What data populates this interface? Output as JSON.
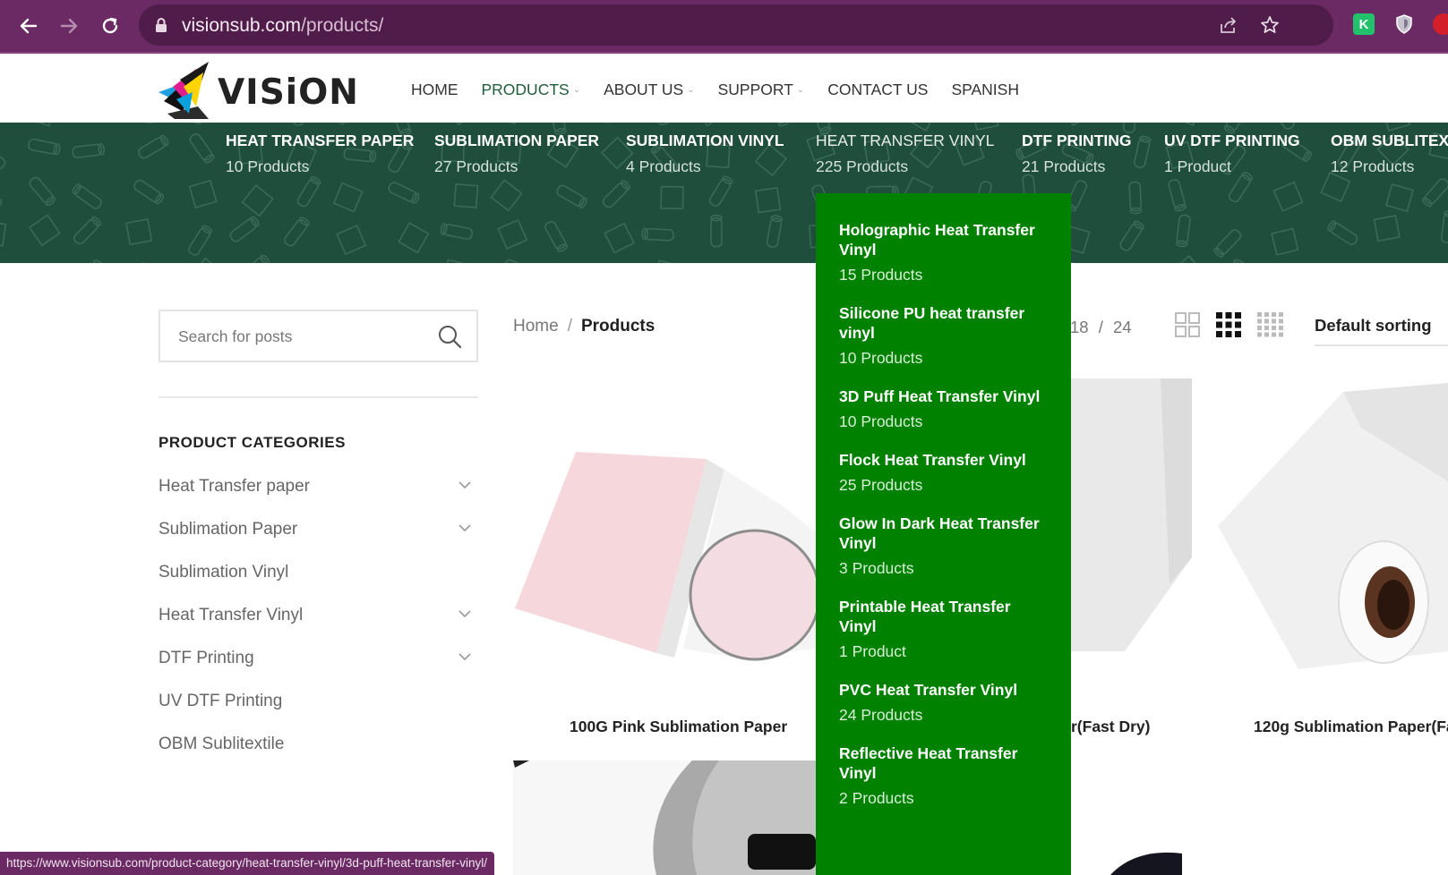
{
  "browser": {
    "url_host": "visionsub.com",
    "url_path": "/products/"
  },
  "site": {
    "logo_text": "VISiON",
    "nav": [
      {
        "label": "HOME",
        "has_dropdown": false,
        "active": false
      },
      {
        "label": "PRODUCTS",
        "has_dropdown": true,
        "active": true
      },
      {
        "label": "ABOUT US",
        "has_dropdown": true,
        "active": false
      },
      {
        "label": "SUPPORT",
        "has_dropdown": true,
        "active": false
      },
      {
        "label": "CONTACT US",
        "has_dropdown": false,
        "active": false
      },
      {
        "label": "SPANISH",
        "has_dropdown": false,
        "active": false
      }
    ]
  },
  "categories_bar": [
    {
      "name": "HEAT TRANSFER PAPER",
      "count": "10 Products"
    },
    {
      "name": "SUBLIMATION PAPER",
      "count": "27 Products"
    },
    {
      "name": "SUBLIMATION VINYL",
      "count": "4 Products"
    },
    {
      "name": "HEAT TRANSFER VINYL",
      "count": "225 Products"
    },
    {
      "name": "DTF PRINTING",
      "count": "21 Products"
    },
    {
      "name": "UV DTF PRINTING",
      "count": "1 Product"
    },
    {
      "name": "OBM SUBLITEXTI",
      "count": "12 Products"
    }
  ],
  "dropdown": [
    {
      "title": "Holographic Heat Transfer Vinyl",
      "count": "15 Products"
    },
    {
      "title": "Silicone PU heat transfer vinyl",
      "count": "10 Products"
    },
    {
      "title": "3D Puff Heat Transfer Vinyl",
      "count": "10 Products"
    },
    {
      "title": "Flock Heat Transfer Vinyl",
      "count": "25 Products"
    },
    {
      "title": "Glow In Dark Heat Transfer Vinyl",
      "count": "3 Products"
    },
    {
      "title": "Printable Heat Transfer Vinyl",
      "count": "1 Product"
    },
    {
      "title": "PVC Heat Transfer Vinyl",
      "count": "24 Products"
    },
    {
      "title": "Reflective Heat Transfer Vinyl",
      "count": "2 Products"
    }
  ],
  "sidebar": {
    "search_placeholder": "Search for posts",
    "title": "PRODUCT CATEGORIES",
    "items": [
      {
        "label": "Heat Transfer paper",
        "expandable": true
      },
      {
        "label": "Sublimation Paper",
        "expandable": true
      },
      {
        "label": "Sublimation Vinyl",
        "expandable": false
      },
      {
        "label": "Heat Transfer Vinyl",
        "expandable": true
      },
      {
        "label": "DTF Printing",
        "expandable": true
      },
      {
        "label": "UV DTF Printing",
        "expandable": false
      },
      {
        "label": "OBM Sublitextile",
        "expandable": false
      }
    ]
  },
  "content": {
    "breadcrumb_home": "Home",
    "breadcrumb_sep": "/",
    "breadcrumb_current": "Products",
    "per_page_a": "18",
    "per_page_sep": "/",
    "per_page_b": "24",
    "sorting": "Default sorting",
    "products": [
      {
        "title": "100G Pink Sublimation Paper"
      },
      {
        "title": "r(Fast Dry)"
      },
      {
        "title": "120g Sublimation Paper(Fa"
      }
    ]
  },
  "status_url": "https://www.visionsub.com/product-category/heat-transfer-vinyl/3d-puff-heat-transfer-vinyl/",
  "colors": {
    "chrome": "#6b2a63",
    "banner": "#1f4e3d",
    "dropdown": "#008100",
    "nav_active": "#1e5c3a"
  }
}
